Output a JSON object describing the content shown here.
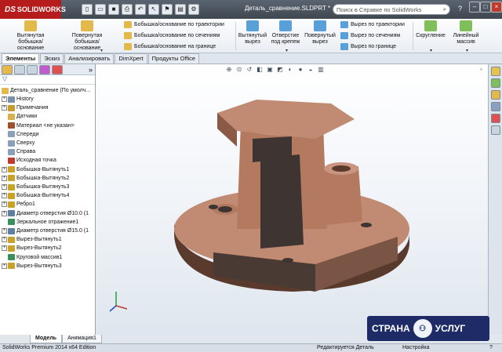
{
  "app": {
    "brand": "SOLIDWORKS",
    "brand_prefix": "DS",
    "title": "Деталь_сравнение.SLDPRT *",
    "search_placeholder": "Поиск в Справке по SolidWorks",
    "help": "?"
  },
  "commands": {
    "extrude_boss": "Вытянутая бобышка/основание",
    "revolve_boss": "Повернутая бобышка/основание",
    "sweep_boss": "Бобышка/основание по траектории",
    "loft_boss": "Бобышка/основание по сечениям",
    "boundary_boss": "Бобышка/основание на границе",
    "extrude_cut": "Вытянутый вырез",
    "hole_wizard": "Отверстие под крепеж",
    "revolve_cut": "Повернутый вырез",
    "sweep_cut": "Вырез по траектории",
    "loft_cut": "Вырез по сечениям",
    "boundary_cut": "Вырез по границе",
    "fillet": "Скругление",
    "linear_pattern": "Линейный массив"
  },
  "tabs": [
    "Элементы",
    "Эскиз",
    "Анализировать",
    "DimXpert",
    "Продукты Office"
  ],
  "tree": {
    "root": "Деталь_сравнение (По умолч...",
    "items": [
      {
        "label": "History",
        "exp": true,
        "icon": "#7a8fb0"
      },
      {
        "label": "Примечания",
        "exp": true,
        "icon": "#c99a2e"
      },
      {
        "label": "Датчики",
        "exp": false,
        "icon": "#d9b04a"
      },
      {
        "label": "Материал <не указан>",
        "exp": false,
        "icon": "#a0522d"
      },
      {
        "label": "Спереди",
        "exp": false,
        "icon": "#8aa0b8"
      },
      {
        "label": "Сверху",
        "exp": false,
        "icon": "#8aa0b8"
      },
      {
        "label": "Справа",
        "exp": false,
        "icon": "#8aa0b8"
      },
      {
        "label": "Исходная точка",
        "exp": false,
        "icon": "#c0392b"
      },
      {
        "label": "Бобышка-Вытянуть1",
        "exp": true,
        "icon": "#c9a227"
      },
      {
        "label": "Бобышка-Вытянуть2",
        "exp": true,
        "icon": "#c9a227"
      },
      {
        "label": "Бобышка-Вытянуть3",
        "exp": true,
        "icon": "#c9a227"
      },
      {
        "label": "Бобышка-Вытянуть4",
        "exp": true,
        "icon": "#c9a227"
      },
      {
        "label": "Ребро1",
        "exp": true,
        "icon": "#c9a227"
      },
      {
        "label": "Диаметр отверстия Ø10.0 (1",
        "exp": true,
        "icon": "#5c7fa3"
      },
      {
        "label": "Зеркальное отражение1",
        "exp": false,
        "icon": "#3a8f5a"
      },
      {
        "label": "Диаметр отверстия Ø15.0 (1",
        "exp": true,
        "icon": "#5c7fa3"
      },
      {
        "label": "Вырез-Вытянуть1",
        "exp": true,
        "icon": "#c9a227"
      },
      {
        "label": "Вырез-Вытянуть2",
        "exp": true,
        "icon": "#c9a227"
      },
      {
        "label": "Круговой массив1",
        "exp": false,
        "icon": "#3a8f5a"
      },
      {
        "label": "Вырез-Вытянуть3",
        "exp": true,
        "icon": "#c9a227"
      }
    ]
  },
  "bottom_tabs": [
    "Модель",
    "Анимация1"
  ],
  "status": {
    "edition": "SolidWorks Premium 2014 x64 Edition",
    "state": "Редактируется Деталь",
    "config": "Настройка"
  },
  "watermark": {
    "text1": "СТРАНА",
    "text2": "УСЛУГ"
  },
  "colors": {
    "part": "#b8826a",
    "part_dark": "#6b4636",
    "accent": "#b71c1c"
  }
}
